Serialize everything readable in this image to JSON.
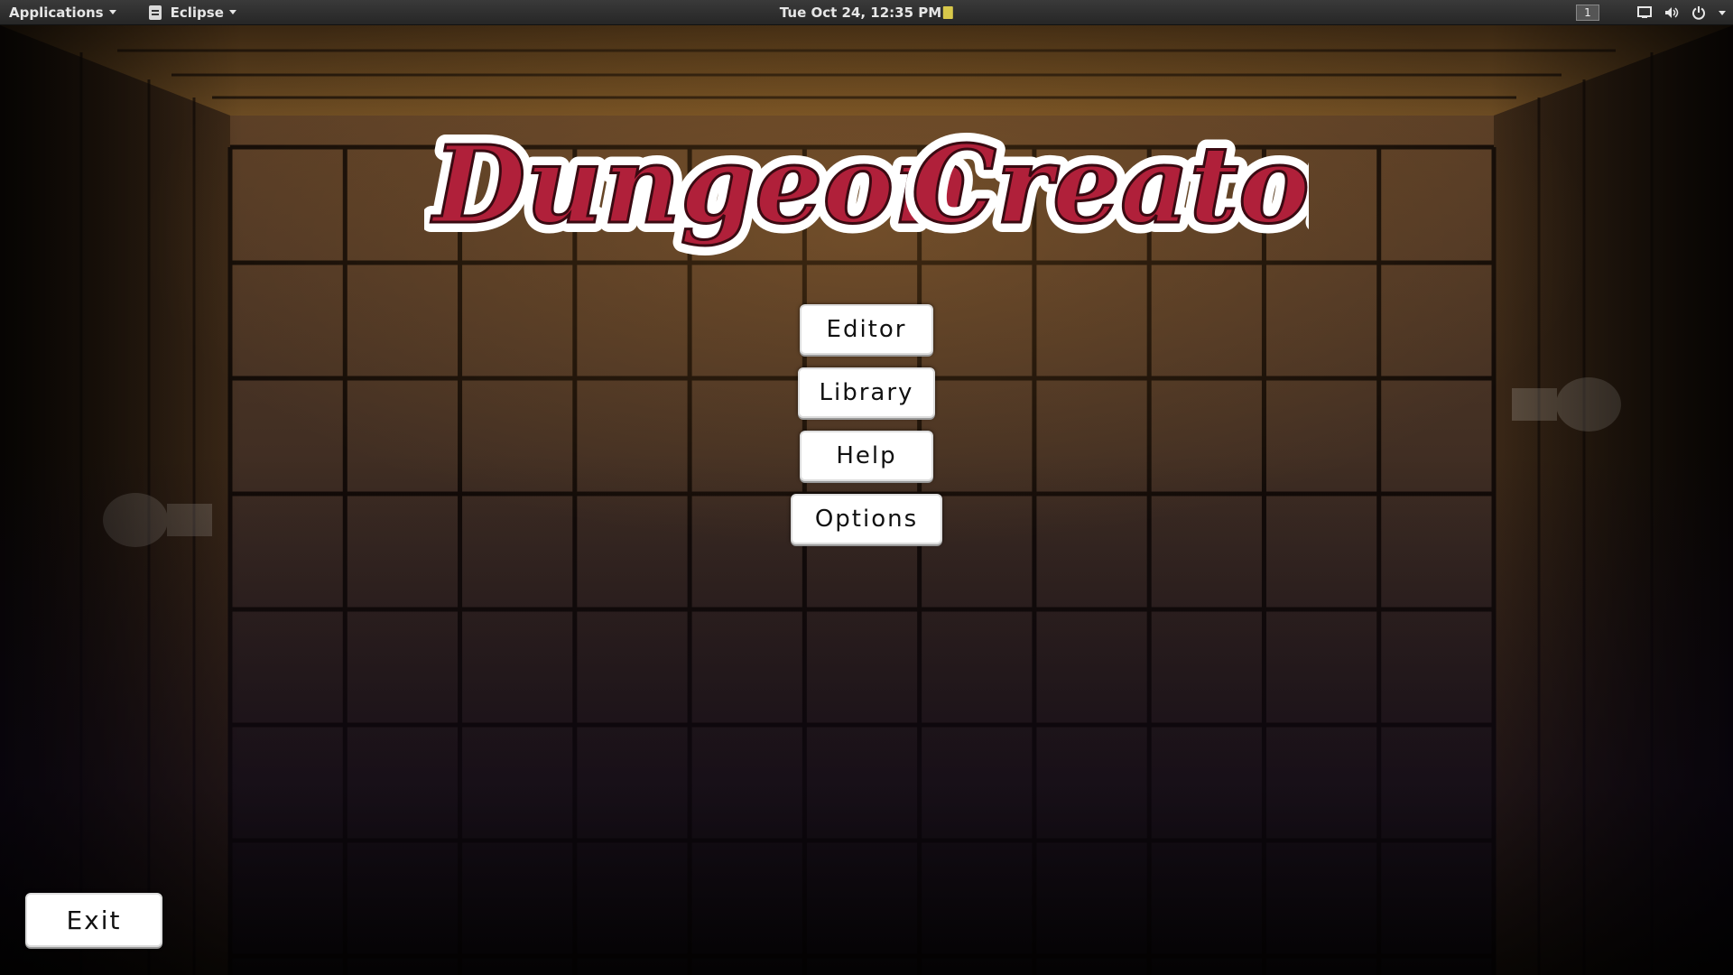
{
  "topbar": {
    "applications_label": "Applications",
    "app_name": "Eclipse",
    "clock": "Tue Oct 24, 12:35 PM",
    "workspace": "1"
  },
  "game": {
    "title_word1": "Dungeon",
    "title_word2": "Creator",
    "title_color": "#b0203a",
    "menu": {
      "editor": "Editor",
      "library": "Library",
      "help": "Help",
      "options": "Options"
    },
    "exit": "Exit"
  },
  "icons": [
    "eclipse-icon",
    "clipboard-note-icon",
    "display-icon",
    "volume-icon",
    "power-icon",
    "chevron-down-icon"
  ]
}
